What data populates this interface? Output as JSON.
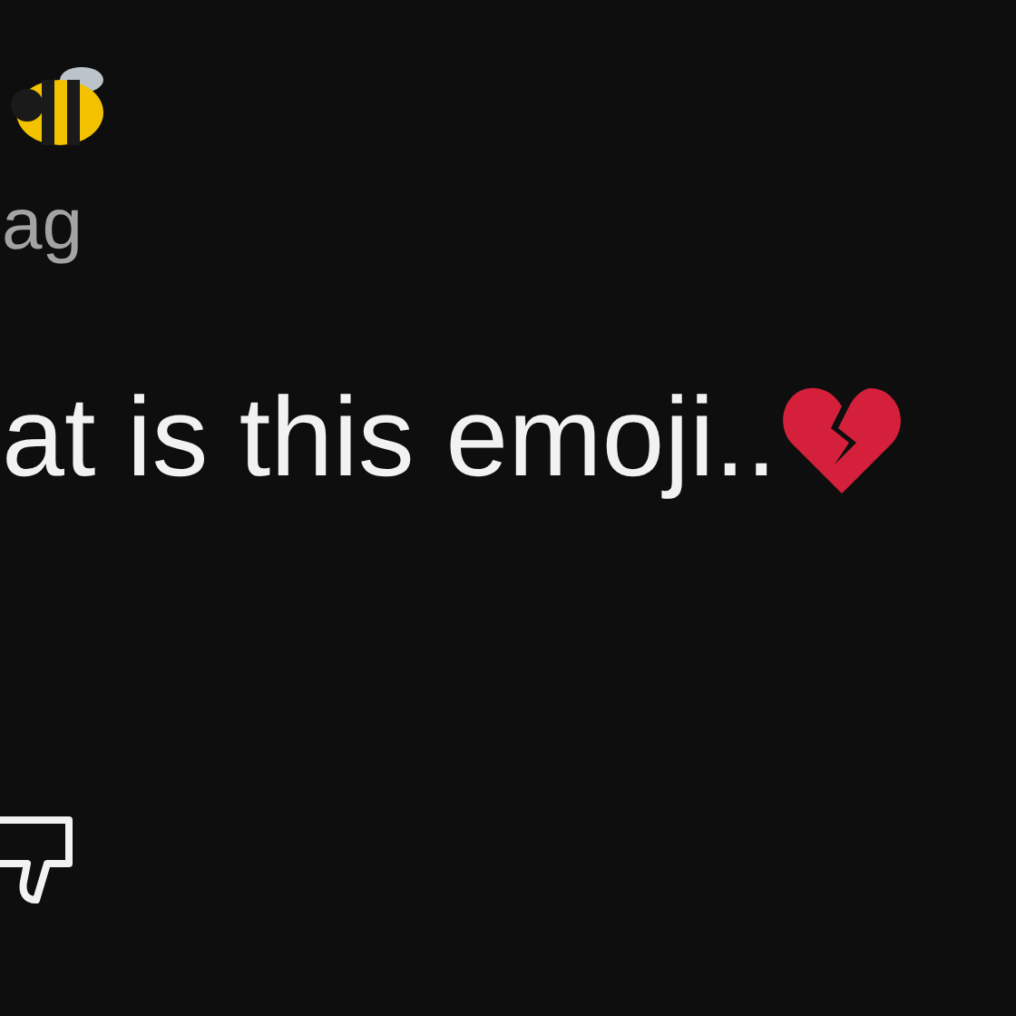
{
  "author": {
    "name": "ag"
  },
  "comment": {
    "text": "at is this emoji.."
  }
}
